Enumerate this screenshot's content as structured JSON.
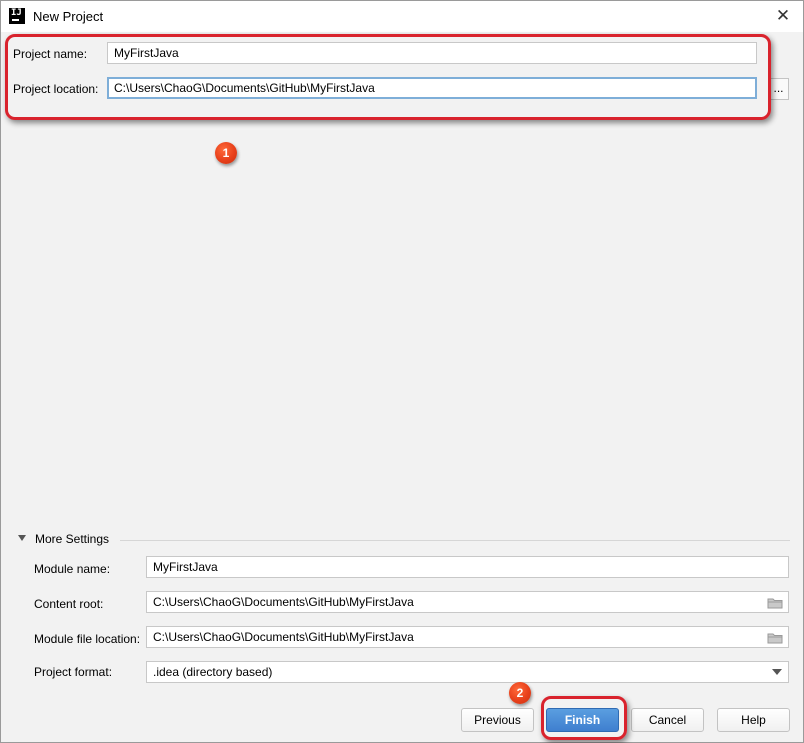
{
  "window": {
    "title": "New Project",
    "app_icon_text": "IJ",
    "close_glyph": "✕"
  },
  "project": {
    "name_label": "Project name:",
    "name_value": "MyFirstJava",
    "location_label": "Project location:",
    "location_value": "C:\\Users\\ChaoG\\Documents\\GitHub\\MyFirstJava",
    "browse_label": "..."
  },
  "annotations": {
    "badge_1": "1",
    "badge_2": "2",
    "highlight_color": "#d9232d",
    "badge_color": "#e8401b"
  },
  "more_settings": {
    "title": "More Settings",
    "expanded": true,
    "module_name_label": "Module name:",
    "module_name_value": "MyFirstJava",
    "content_root_label": "Content root:",
    "content_root_value": "C:\\Users\\ChaoG\\Documents\\GitHub\\MyFirstJava",
    "module_file_label": "Module file location:",
    "module_file_value": "C:\\Users\\ChaoG\\Documents\\GitHub\\MyFirstJava",
    "format_label": "Project format:",
    "format_value": ".idea (directory based)",
    "folder_icon": "folder-icon"
  },
  "buttons": {
    "previous": "Previous",
    "finish": "Finish",
    "cancel": "Cancel",
    "help": "Help",
    "primary_color": "#4a8fdb"
  }
}
